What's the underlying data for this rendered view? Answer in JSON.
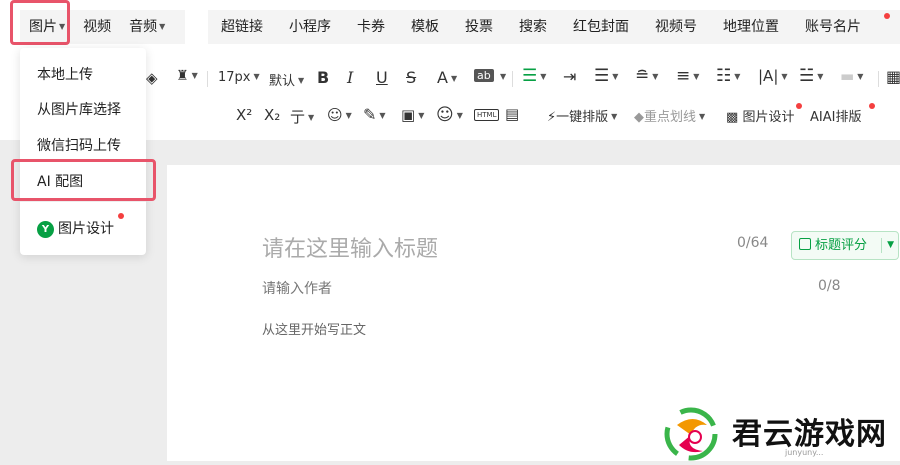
{
  "top_tabs": {
    "left": [
      {
        "label": "图片",
        "caret": true
      },
      {
        "label": "视频",
        "caret": false
      },
      {
        "label": "音频",
        "caret": true
      }
    ],
    "right": [
      "超链接",
      "小程序",
      "卡券",
      "模板",
      "投票",
      "搜索",
      "红包封面",
      "视频号",
      "地理位置",
      "账号名片"
    ]
  },
  "toolbar": {
    "font_size": "17px",
    "font_family": "默认",
    "one_click_layout": "一键排版",
    "highlight_line": "重点划线",
    "image_design": "图片设计",
    "ai_layout": "AI排版",
    "ai_icon_text": "AI",
    "html_icon_text": "HTML",
    "ab_icon_text": "ab"
  },
  "image_menu": {
    "items": [
      "本地上传",
      "从图片库选择",
      "微信扫码上传",
      "AI 配图"
    ],
    "design_label": "图片设计",
    "design_icon_text": "Y"
  },
  "editor": {
    "title_placeholder": "请在这里输入标题",
    "title_count": "0/64",
    "title_score_button": "标题评分",
    "author_placeholder": "请输入作者",
    "author_count": "0/8",
    "body_placeholder": "从这里开始写正文"
  },
  "watermark": {
    "text": "君云游戏网",
    "sub": "junyuny..."
  },
  "colors": {
    "accent_green": "#07a044",
    "highlight_red": "#e8546a",
    "dot_red": "#f43f3f"
  }
}
